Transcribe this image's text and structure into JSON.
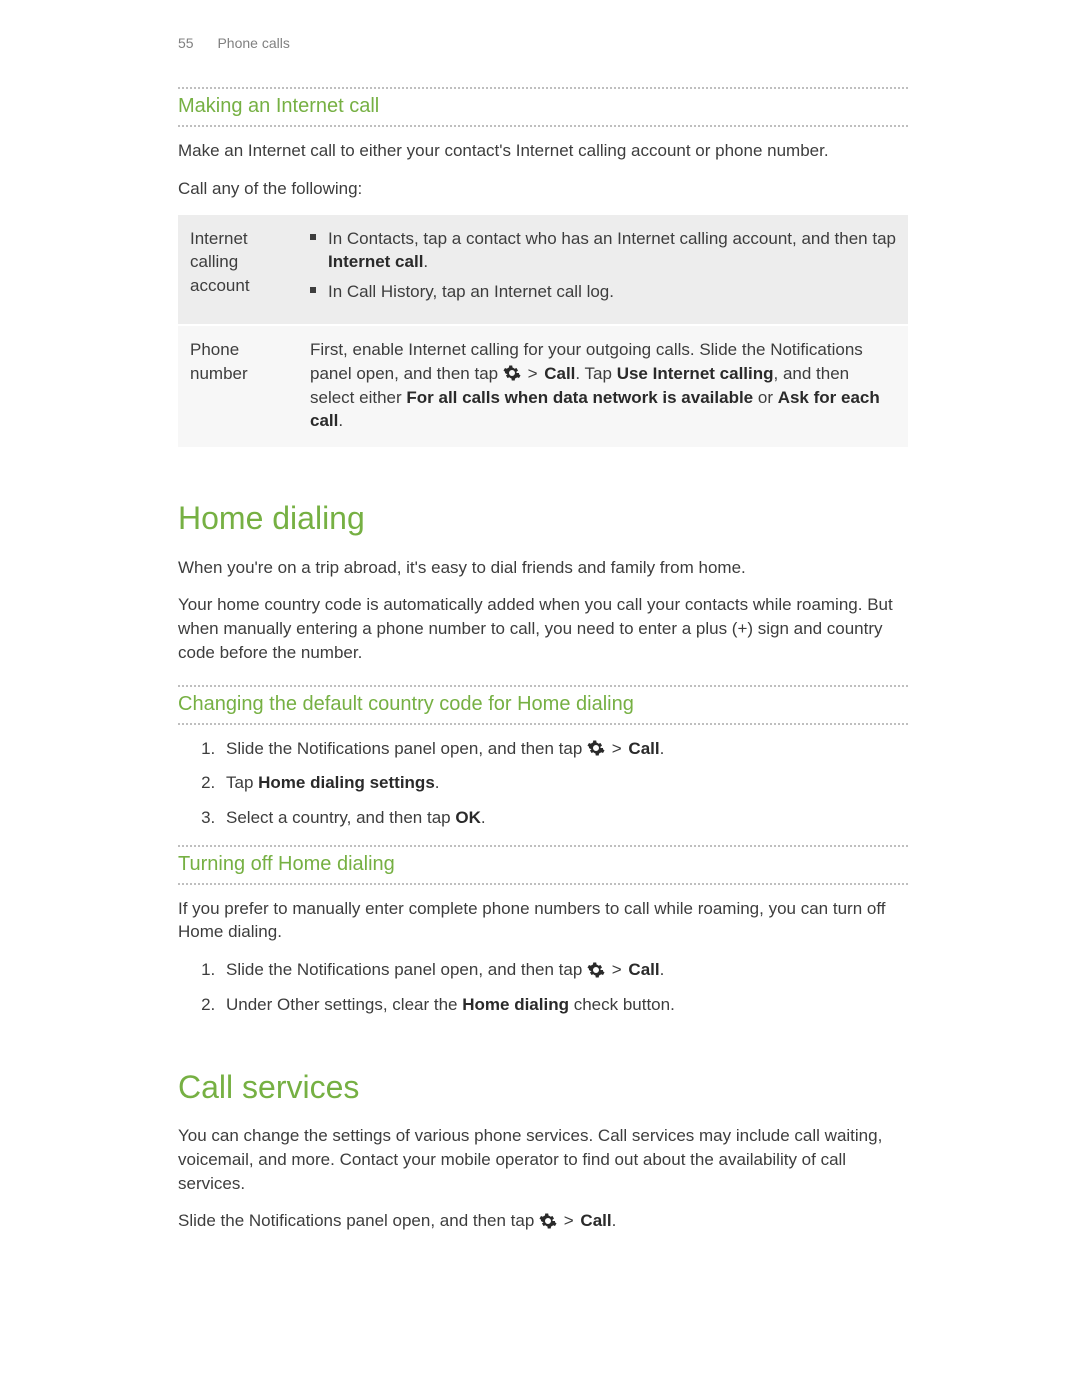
{
  "pageHeader": {
    "pageNumber": "55",
    "title": "Phone calls"
  },
  "colors": {
    "accent": "#76b043"
  },
  "sec_making": {
    "heading": "Making an Internet call",
    "intro": "Make an Internet call to either your contact's Internet calling account or phone number.",
    "lead": "Call any of the following:",
    "table": {
      "row1": {
        "label": "Internet calling account",
        "b1a": "In Contacts, tap a contact who has an Internet calling account, and then tap ",
        "b1b": "Internet call",
        "b1c": ".",
        "b2": "In Call History, tap an Internet call log."
      },
      "row2": {
        "label": "Phone number",
        "t1": "First, enable Internet calling for your outgoing calls. Slide the Notifications panel open, and then tap ",
        "t2": " > ",
        "t3": "Call",
        "t4": ". Tap ",
        "t5": "Use Internet calling",
        "t6": ", and then select either ",
        "t7": "For all calls when data network is available",
        "t8": " or ",
        "t9": "Ask for each call",
        "t10": "."
      }
    }
  },
  "sec_home": {
    "heading": "Home dialing",
    "p1": "When you're on a trip abroad, it's easy to dial friends and family from home.",
    "p2": "Your home country code is automatically added when you call your contacts while roaming. But when manually entering a phone number to call, you need to enter a plus (+) sign and country code before the number."
  },
  "sec_change": {
    "heading": "Changing the default country code for Home dialing",
    "step1a": "Slide the Notifications panel open, and then tap ",
    "step1gt": " > ",
    "step1b": "Call",
    "step1c": ".",
    "step2a": "Tap ",
    "step2b": "Home dialing settings",
    "step2c": ".",
    "step3a": "Select a country, and then tap ",
    "step3b": "OK",
    "step3c": "."
  },
  "sec_turnoff": {
    "heading": "Turning off Home dialing",
    "p": "If you prefer to manually enter complete phone numbers to call while roaming, you can turn off Home dialing.",
    "step1a": "Slide the Notifications panel open, and then tap ",
    "step1gt": " > ",
    "step1b": "Call",
    "step1c": ".",
    "step2a": "Under Other settings, clear the ",
    "step2b": "Home dialing",
    "step2c": " check button."
  },
  "sec_services": {
    "heading": "Call services",
    "p1": "You can change the settings of various phone services. Call services may include call waiting, voicemail, and more. Contact your mobile operator to find out about the availability of call services.",
    "p2a": "Slide the Notifications panel open, and then tap ",
    "p2gt": " > ",
    "p2b": "Call",
    "p2c": "."
  }
}
